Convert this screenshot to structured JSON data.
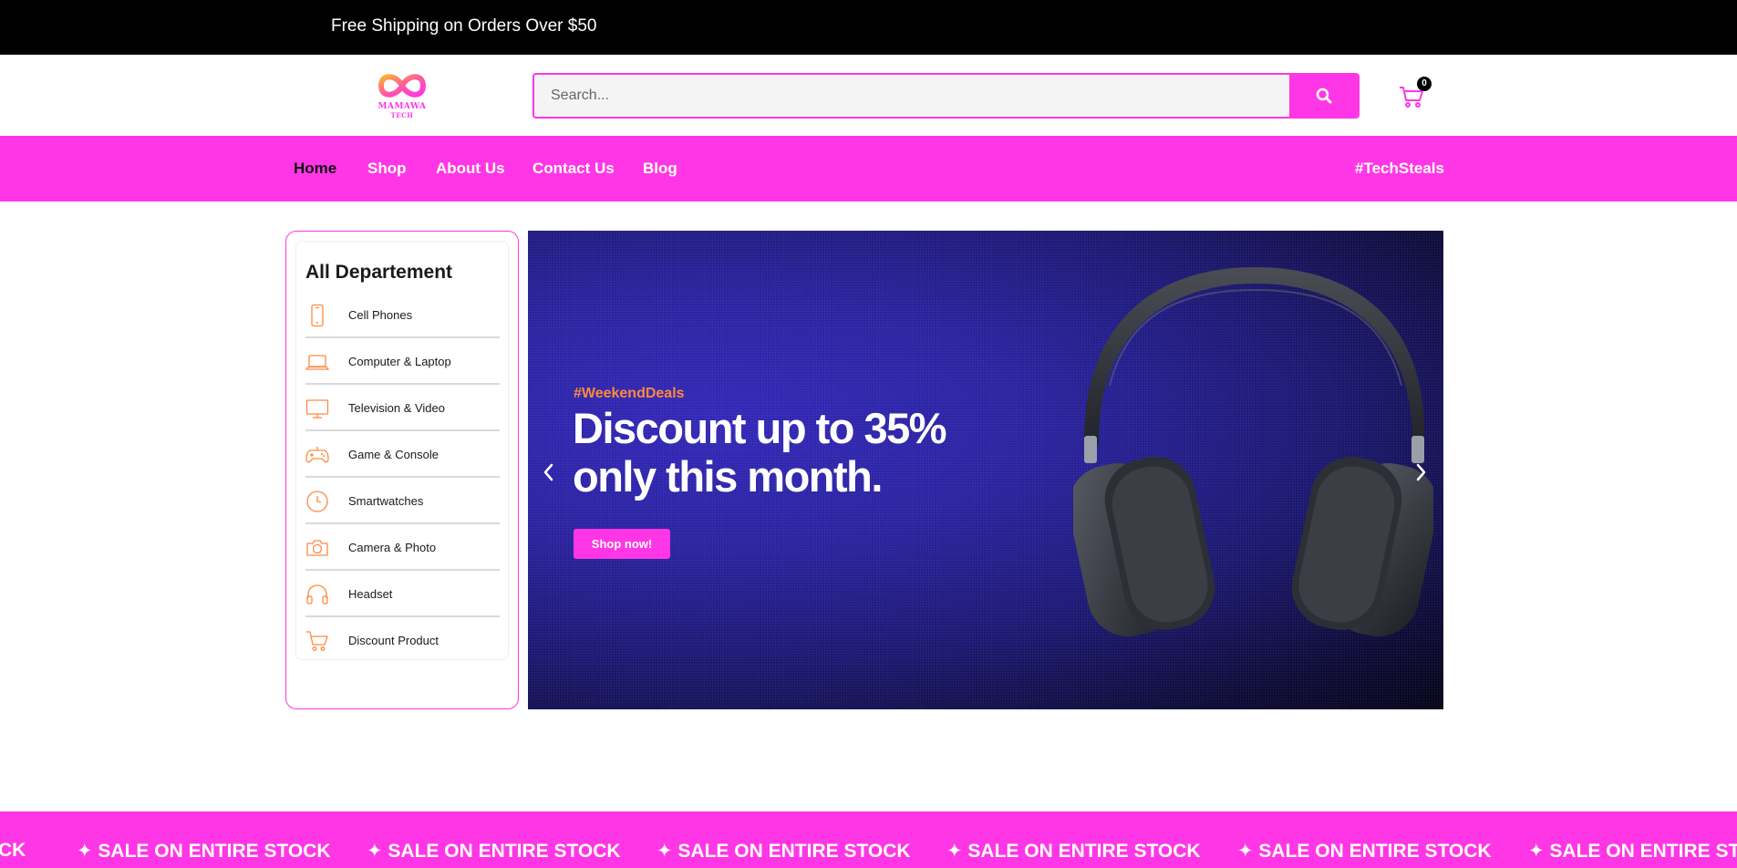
{
  "topbar": {
    "promo": "Free Shipping on Orders Over $50"
  },
  "header": {
    "logo": {
      "name": "MAMAWA",
      "sub": "TECH"
    },
    "search": {
      "placeholder": "Search...",
      "button_icon": "search-icon"
    },
    "cart": {
      "icon": "cart-icon",
      "count": "0"
    }
  },
  "nav": {
    "items": [
      {
        "label": "Home",
        "active": true
      },
      {
        "label": "Shop"
      },
      {
        "label": "About Us"
      },
      {
        "label": "Contact Us"
      },
      {
        "label": "Blog"
      }
    ],
    "tag": "#TechSteals"
  },
  "departments": {
    "title": "All Departement",
    "items": [
      {
        "label": "Cell Phones",
        "icon": "phone-icon"
      },
      {
        "label": "Computer & Laptop",
        "icon": "laptop-icon"
      },
      {
        "label": "Television & Video",
        "icon": "monitor-icon"
      },
      {
        "label": "Game & Console",
        "icon": "gamepad-icon"
      },
      {
        "label": "Smartwatches",
        "icon": "clock-icon"
      },
      {
        "label": "Camera & Photo",
        "icon": "camera-icon"
      },
      {
        "label": "Headset",
        "icon": "headphones-icon"
      },
      {
        "label": "Discount Product",
        "icon": "cart-icon"
      }
    ],
    "icon_color": "#ff8a3d"
  },
  "hero": {
    "tag": "#WeekendDeals",
    "title_line1": "Discount up to 35%",
    "title_line2": "only this month.",
    "button": "Shop now!"
  },
  "ticker": {
    "text": "✦ SALE ON ENTIRE STOCK",
    "partial": "CK"
  },
  "colors": {
    "brand": "#ff36e6",
    "accent": "#ff8a3d",
    "topbar": "#000000"
  }
}
